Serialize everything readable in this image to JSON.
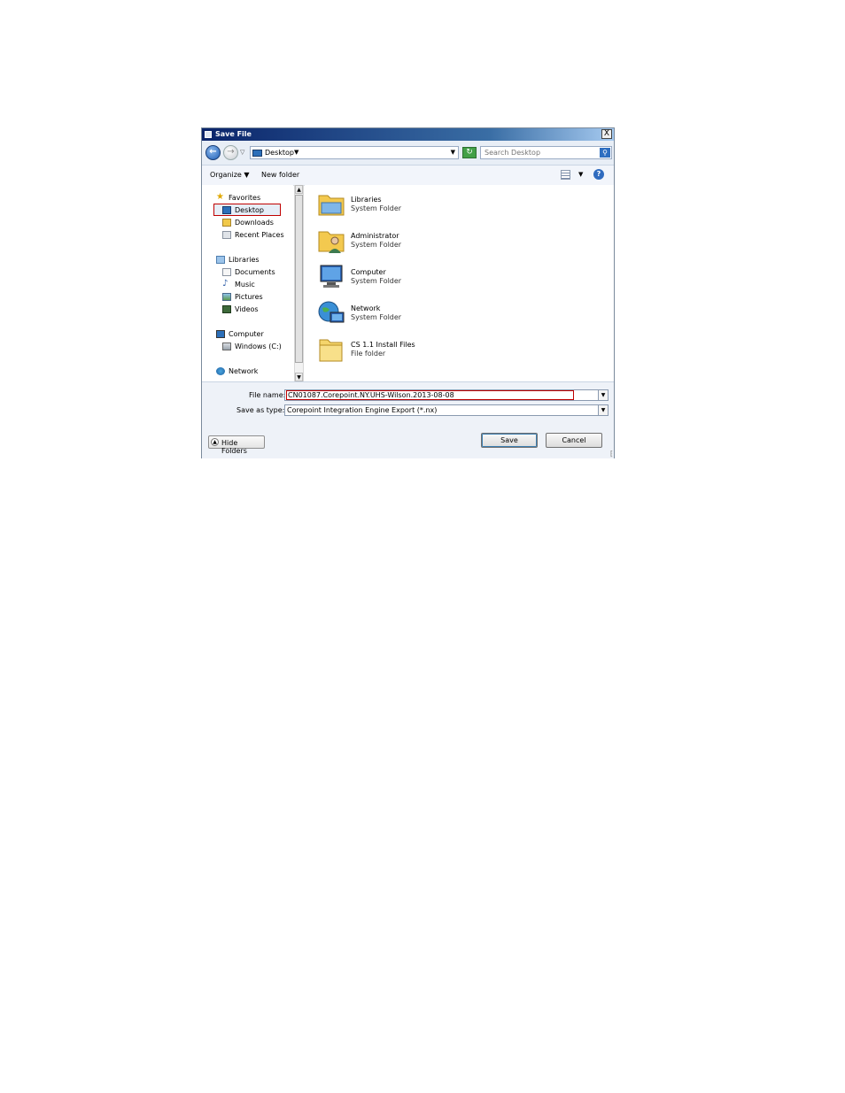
{
  "dialog": {
    "title": "Save File",
    "close_label": "X"
  },
  "address": {
    "back_icon": "back-arrow-icon",
    "forward_icon": "forward-arrow-icon",
    "location": "Desktop",
    "search_placeholder": "Search Desktop"
  },
  "toolbar": {
    "organize_label": "Organize",
    "new_folder_label": "New folder"
  },
  "sidebar": {
    "favorites_label": "Favorites",
    "desktop_label": "Desktop",
    "downloads_label": "Downloads",
    "recent_label": "Recent Places",
    "libraries_label": "Libraries",
    "documents_label": "Documents",
    "music_label": "Music",
    "pictures_label": "Pictures",
    "videos_label": "Videos",
    "computer_label": "Computer",
    "windows_label": "Windows (C:)",
    "network_label": "Network"
  },
  "content": {
    "items": [
      {
        "name": "Libraries",
        "type": "System Folder"
      },
      {
        "name": "Administrator",
        "type": "System Folder"
      },
      {
        "name": "Computer",
        "type": "System Folder"
      },
      {
        "name": "Network",
        "type": "System Folder"
      },
      {
        "name": "CS 1.1 Install Files",
        "type": "File folder"
      }
    ]
  },
  "form": {
    "file_name_label": "File name:",
    "file_name_value": "CN01087.Corepoint.NY.UHS-Wilson.2013-08-08",
    "save_type_label": "Save as type:",
    "save_type_value": "Corepoint Integration Engine Export (*.nx)",
    "hide_folders_label": "Hide Folders",
    "save_label": "Save",
    "cancel_label": "Cancel"
  },
  "colors": {
    "highlight_border": "#c00000",
    "title_bar": "#0a246a"
  }
}
